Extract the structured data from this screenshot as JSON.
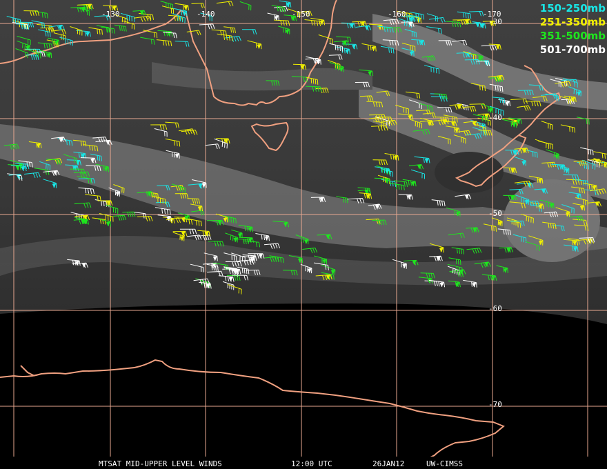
{
  "lon_labels": [
    "-130",
    "-140",
    "-150",
    "-160",
    "-170"
  ],
  "lat_labels": [
    "-30",
    "-40",
    "-50",
    "-60",
    "-70"
  ],
  "legend": [
    {
      "label": "150-250mb",
      "color": "#19e6e6"
    },
    {
      "label": "251-350mb",
      "color": "#f0f000"
    },
    {
      "label": "351-500mb",
      "color": "#1ee61e"
    },
    {
      "label": "501-700mb",
      "color": "#ffffff"
    }
  ],
  "footer": {
    "product": "MTSAT MID-UPPER LEVEL WINDS",
    "time": "12:00 UTC",
    "date": "26JAN12",
    "source": "UW-CIMSS"
  },
  "colors": {
    "grid": "#e8a890",
    "coastline": "#f0a080",
    "background": "#000000",
    "imagery": "#3a3a3a"
  }
}
